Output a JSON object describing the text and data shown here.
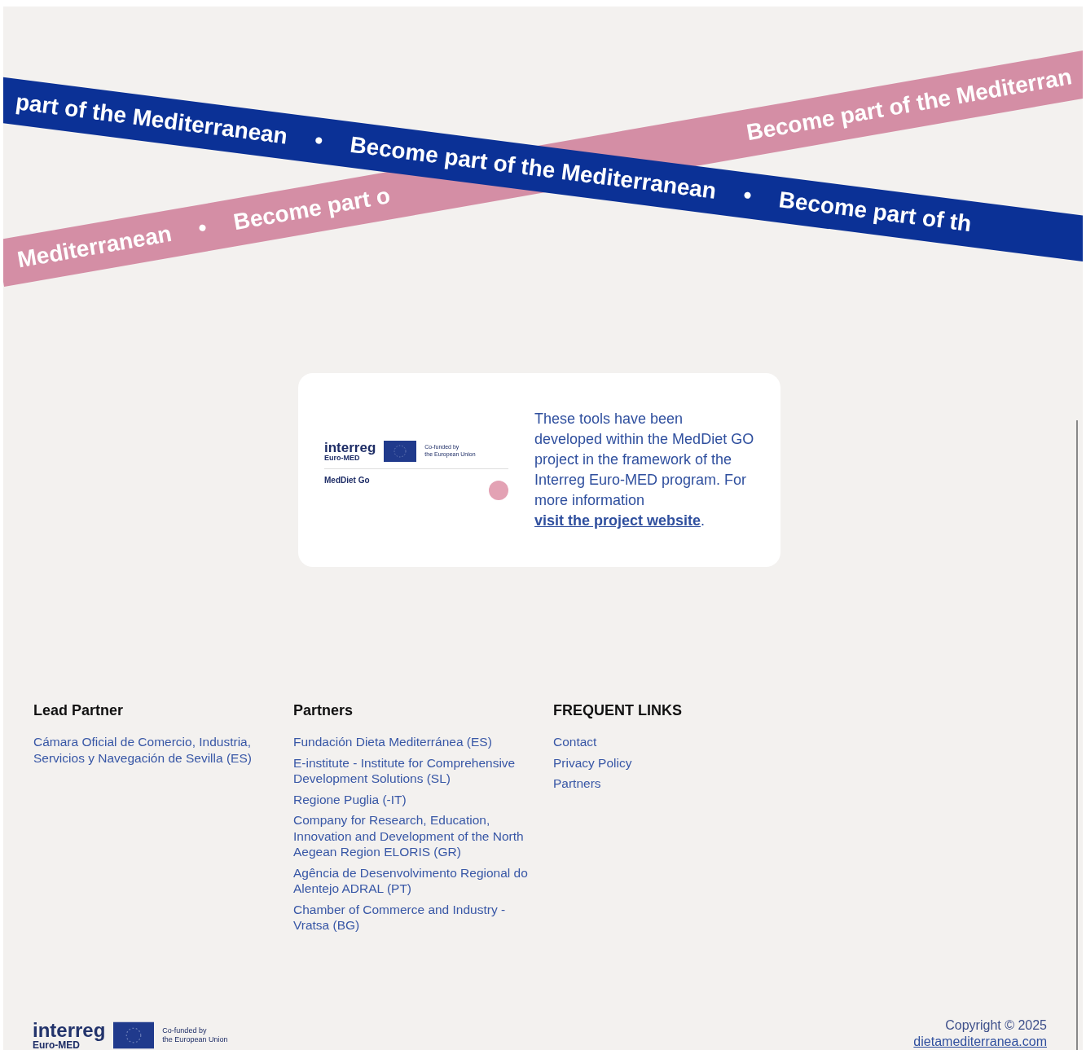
{
  "banner": {
    "blue_ribbon": {
      "segments": [
        "part of the Mediterranean",
        "•",
        "Become part of the Mediterranean",
        "•",
        "Become part of th"
      ]
    },
    "pink_ribbon": {
      "left_segments": [
        "Mediterranean",
        "•",
        "Become part o"
      ],
      "right_segments": [
        "Become part of the Mediterran"
      ]
    }
  },
  "info_card": {
    "logo": {
      "brand": "interreg",
      "program": "Euro-MED",
      "funding": [
        "Co-funded by",
        "the European Union"
      ],
      "project": "MedDiet Go"
    },
    "text": "These tools have been developed within the MedDiet GO project in the framework of the Interreg Euro-MED program. For more information ",
    "link": "visit the project website",
    "after_link": "."
  },
  "footer": {
    "columns": [
      {
        "heading": "Lead Partner",
        "links": [
          "Cámara Oficial de Comercio, Industria, Servicios y Navegación de Sevilla (ES)"
        ]
      },
      {
        "heading": "Partners",
        "links": [
          "Fundación Dieta Mediterránea (ES)",
          "E-institute - Institute for Comprehensive Development Solutions (SL)",
          "Regione Puglia (-IT)",
          "Company for Research, Education, Innovation and Development of the North Aegean Region ELORIS (GR)",
          "Agência de Desenvolvimento Regional do Alentejo ADRAL (PT)",
          "Chamber of Commerce and Industry - Vratsa (BG)"
        ]
      },
      {
        "heading": "FREQUENT LINKS",
        "links": [
          "Contact",
          "Privacy Policy",
          "Partners"
        ]
      }
    ],
    "logo": {
      "brand": "interreg",
      "program": "Euro-MED",
      "funding": [
        "Co-funded by",
        "the European Union"
      ]
    },
    "copyright": "Copyright © 2025",
    "site": "dietamediterranea.com"
  }
}
